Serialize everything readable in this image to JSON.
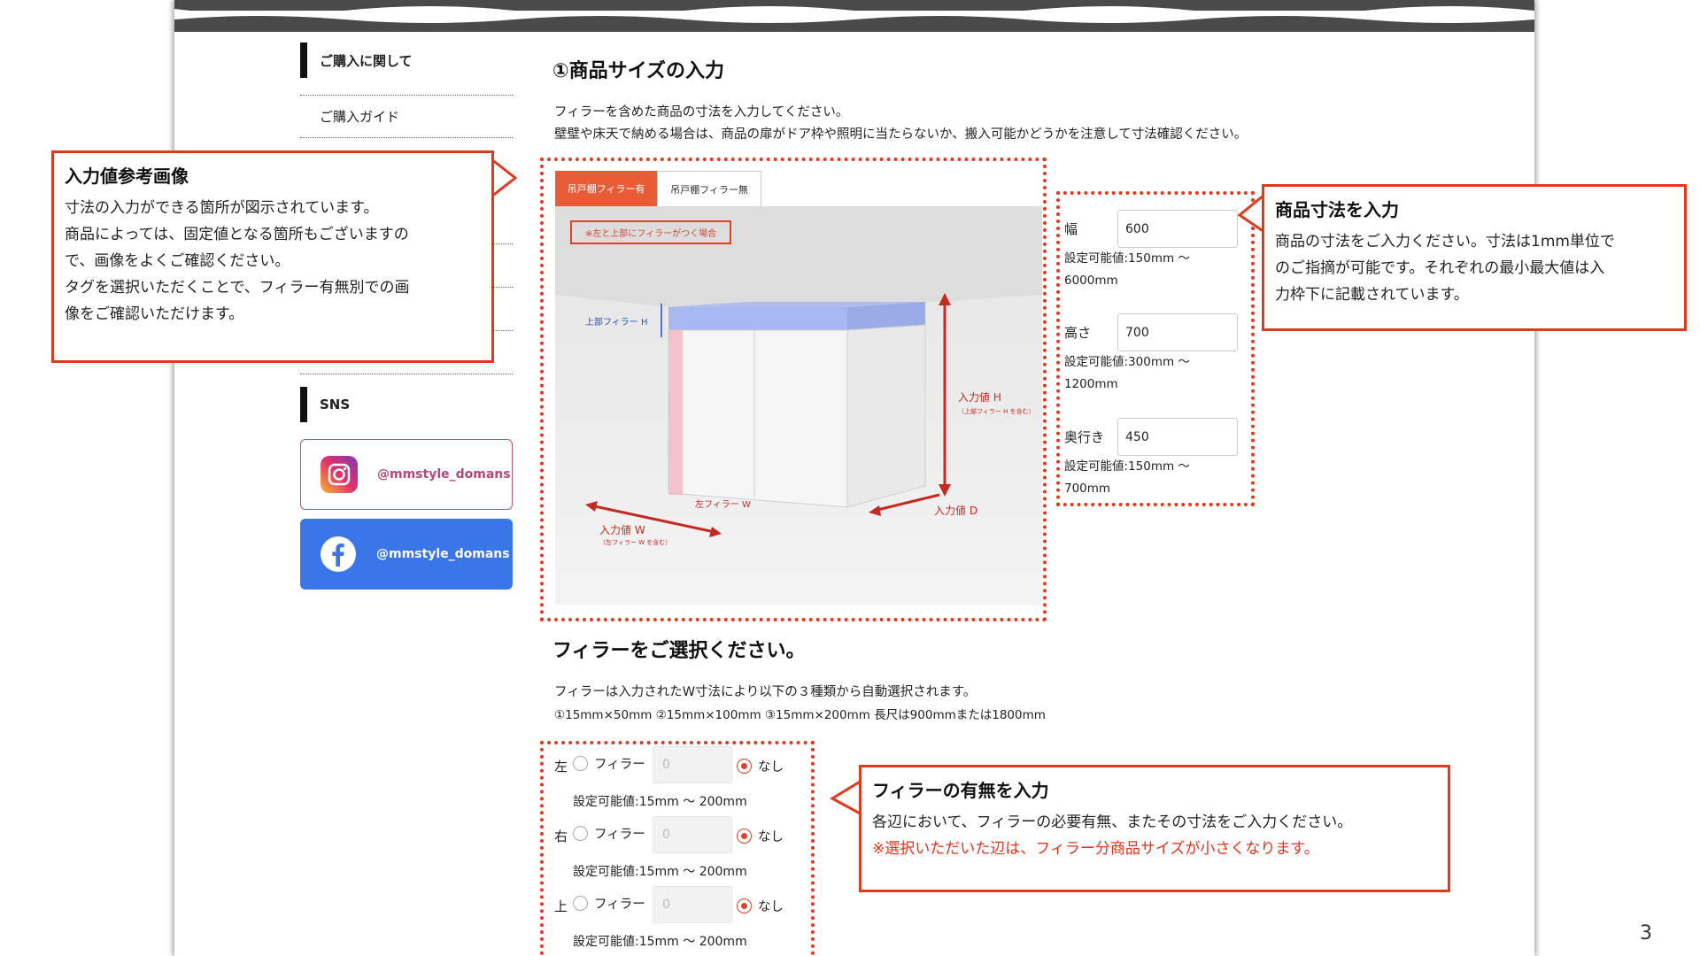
{
  "sidebar": {
    "top_heading": "ご購入に関して",
    "items": [
      {
        "label": "ご購入ガイド"
      }
    ],
    "sns_heading": "SNS",
    "instagram": "@mmstyle_domans",
    "facebook": "@mmstyle_domans"
  },
  "size_section": {
    "title": "①商品サイズの入力",
    "desc_line1": "フィラーを含めた商品の寸法を入力してください。",
    "desc_line2": "壁壁や床天で納める場合は、商品の扉がドア枠や照明に当たらないか、搬入可能かどうかを注意して寸法確認ください。",
    "tabs": [
      "吊戸棚フィラー有",
      "吊戸棚フィラー無"
    ],
    "image_note": "※左と上部にフィラーがつく場合",
    "image_labels": {
      "top_filler": "上部フィラー H",
      "input_h": "入力値 H",
      "input_h_note": "（上部フィラー H を含む）",
      "left_filler": "左フィラー W",
      "input_w": "入力値 W",
      "input_w_note": "（左フィラー W を含む）",
      "input_d": "入力値 D"
    }
  },
  "dimensions": [
    {
      "label": "幅",
      "value": "600",
      "range1": "設定可能値:150mm 〜",
      "range2": "6000mm"
    },
    {
      "label": "高さ",
      "value": "700",
      "range1": "設定可能値:300mm 〜",
      "range2": "1200mm"
    },
    {
      "label": "奥行き",
      "value": "450",
      "range1": "設定可能値:150mm 〜",
      "range2": "700mm"
    }
  ],
  "filler_section": {
    "title": "フィラーをご選択ください。",
    "desc_line1": "フィラーは入力されたW寸法により以下の３種類から自動選択されます。",
    "desc_line2": "①15mm×50mm ②15mm×100mm ③15mm×200mm 長尺は900mmまたは1800mm",
    "rows": [
      {
        "side": "左",
        "filler_label": "フィラー",
        "placeholder": "0",
        "none_label": "なし",
        "range": "設定可能値:15mm 〜 200mm"
      },
      {
        "side": "右",
        "filler_label": "フィラー",
        "placeholder": "0",
        "none_label": "なし",
        "range": "設定可能値:15mm 〜 200mm"
      },
      {
        "side": "上",
        "filler_label": "フィラー",
        "placeholder": "0",
        "none_label": "なし",
        "range": "設定可能値:15mm 〜 200mm"
      }
    ]
  },
  "callouts": {
    "image": {
      "title": "入力値参考画像",
      "lines": [
        "寸法の入力ができる箇所が図示されています。",
        "商品によっては、固定値となる箇所もございますの",
        "で、画像をよくご確認ください。",
        "タグを選択いただくことで、フィラー有無別での画",
        "像をご確認いただけます。"
      ]
    },
    "size": {
      "title": "商品寸法を入力",
      "lines": [
        "商品の寸法をご入力ください。寸法は1mm単位で",
        "のご指摘が可能です。それぞれの最小最大値は入",
        "力枠下に記載されています。"
      ]
    },
    "filler": {
      "title": "フィラーの有無を入力",
      "line1": "各辺において、フィラーの必要有無、またその寸法をご入力ください。",
      "line2_red": "※選択いただいた辺は、フィラー分商品サイズが小さくなります。"
    }
  },
  "page_number": "3",
  "colors": {
    "accent": "#e03a1e",
    "tab_active": "#e85c36",
    "facebook": "#3b76e8",
    "instagram": "#c04f7f"
  }
}
